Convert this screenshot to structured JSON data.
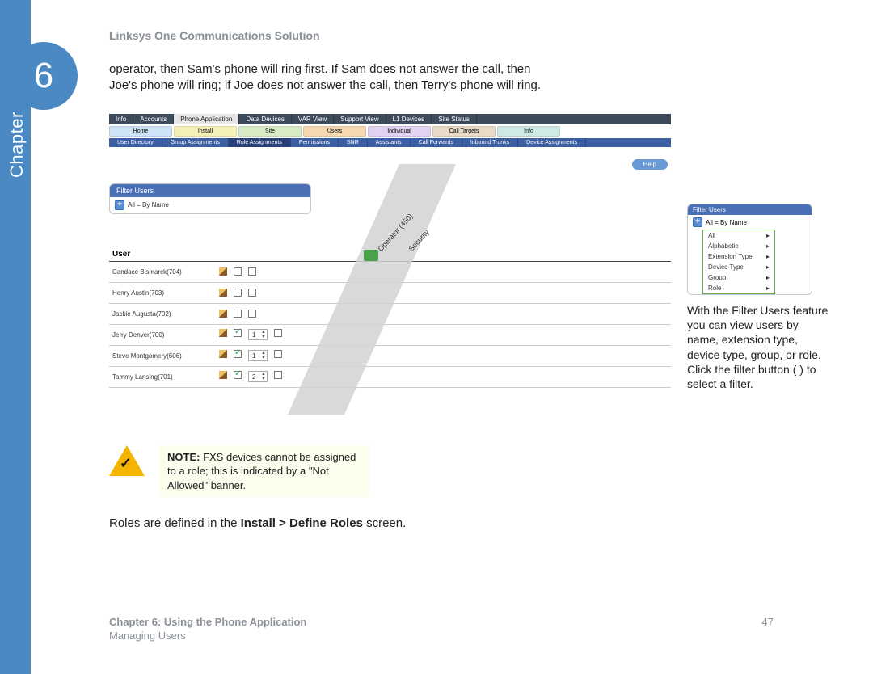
{
  "spine": {
    "label": "Chapter",
    "number": "6"
  },
  "doc_title": "Linksys One Communications Solution",
  "body_para": "operator, then Sam's phone will ring first. If Sam does not answer the call, then Joe's phone will ring; if Joe does not answer the call, then Terry's phone will ring.",
  "top_tabs": [
    "Info",
    "Accounts",
    "Phone Application",
    "Data Devices",
    "VAR View",
    "Support View",
    "L1 Devices",
    "Site Status"
  ],
  "top_tabs_active": "Phone Application",
  "nav_pills": [
    {
      "label": "Home",
      "cls": "blue"
    },
    {
      "label": "Install",
      "cls": "yellow"
    },
    {
      "label": "Site",
      "cls": "green"
    },
    {
      "label": "Users",
      "cls": "orange"
    },
    {
      "label": "Individual",
      "cls": "purple"
    },
    {
      "label": "Call Targets",
      "cls": "tan"
    },
    {
      "label": "Info",
      "cls": "teal"
    }
  ],
  "sub_tabs": [
    "User Directory",
    "Group Assignments",
    "Role Assignments",
    "Permissions",
    "SNR",
    "Assistants",
    "Call Forwards",
    "Inbound Trunks",
    "Device Assignments"
  ],
  "sub_tabs_active": "Role Assignments",
  "help_label": "Help",
  "filter": {
    "title": "Filter Users",
    "value": "All = By Name"
  },
  "diag_headers": {
    "operator": "Operator (450)",
    "security": "Security"
  },
  "table_header": "User",
  "users": [
    {
      "name": "Candace Bismarck(704)",
      "check": false,
      "stepper": null
    },
    {
      "name": "Henry Austin(703)",
      "check": false,
      "stepper": null
    },
    {
      "name": "Jackie Augusta(702)",
      "check": false,
      "stepper": null
    },
    {
      "name": "Jerry Denver(700)",
      "check": true,
      "stepper": "1"
    },
    {
      "name": "Steve Montgomery(606)",
      "check": true,
      "stepper": "1"
    },
    {
      "name": "Tammy Lansing(701)",
      "check": true,
      "stepper": "2"
    }
  ],
  "sidebar": {
    "filter_title": "Filter Users",
    "filter_value": "All = By Name",
    "menu": [
      "All",
      "Alphabetic",
      "Extension Type",
      "Device Type",
      "Group",
      "Role"
    ],
    "text": "With the Filter Users feature you can view users by name, extension type, device type, group, or role. Click the filter button (  ) to select a filter."
  },
  "note": {
    "label": "NOTE:",
    "text": " FXS devices cannot be assigned to a role; this is indicated by a \"Not Allowed\" banner."
  },
  "after_note_pre": "Roles are defined in the ",
  "after_note_bold": "Install > Define Roles",
  "after_note_post": " screen.",
  "footer": {
    "chapter": "Chapter 6: Using the Phone Application",
    "section": "Managing Users",
    "page": "47"
  },
  "chart_data": {
    "type": "table",
    "title": "Role Assignments",
    "columns": [
      "User",
      "Operator (450)",
      "Security"
    ],
    "rows": [
      {
        "User": "Candace Bismarck(704)",
        "Operator (450)": null,
        "Security": null
      },
      {
        "User": "Henry Austin(703)",
        "Operator (450)": null,
        "Security": null
      },
      {
        "User": "Jackie Augusta(702)",
        "Operator (450)": null,
        "Security": null
      },
      {
        "User": "Jerry Denver(700)",
        "Operator (450)": 1,
        "Security": null
      },
      {
        "User": "Steve Montgomery(606)",
        "Operator (450)": 1,
        "Security": null
      },
      {
        "User": "Tammy Lansing(701)",
        "Operator (450)": 2,
        "Security": null
      }
    ]
  }
}
